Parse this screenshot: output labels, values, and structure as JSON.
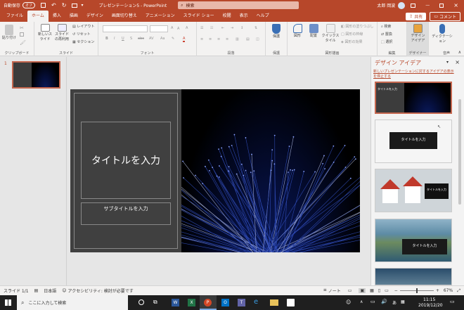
{
  "titlebar": {
    "autosave": "自動保存",
    "autosave_state": "オフ",
    "doc_title": "プレゼンテーション5 - PowerPoint",
    "search_placeholder": "検索",
    "user": "太郎 岡波"
  },
  "tabs": [
    "ファイル",
    "ホーム",
    "挿入",
    "描画",
    "デザイン",
    "画面切り替え",
    "アニメーション",
    "スライド ショー",
    "校閲",
    "表示",
    "ヘルプ"
  ],
  "share": "共有",
  "comment": "コメント",
  "ribbon": {
    "clipboard": {
      "paste": "貼り付け",
      "label": "クリップボード"
    },
    "slides": {
      "new": "新しいスライド",
      "reuse": "スライドの再利用",
      "layout": "レイアウト",
      "reset": "リセット",
      "section": "セクション",
      "label": "スライド"
    },
    "font": {
      "label": "フォント"
    },
    "paragraph": {
      "label": "段落"
    },
    "protect": {
      "btn": "保護",
      "label": "保護"
    },
    "draw": {
      "shapes": "図形",
      "arrange": "配置",
      "quickstyle": "クイックスタイル",
      "fill": "図形の塗りつぶし",
      "outline": "図形の枠線",
      "effect": "図形の効果",
      "label": "図形描画"
    },
    "edit": {
      "find": "検索",
      "replace": "置換",
      "select": "選択",
      "label": "編集"
    },
    "designer": {
      "btn": "デザインアイデア",
      "label": "デザイナー"
    },
    "voice": {
      "btn": "ディクテーション",
      "label": "音声"
    }
  },
  "slide": {
    "number": "1",
    "title": "タイトルを入力",
    "subtitle": "サブタイトルを入力"
  },
  "pane": {
    "title": "デザイン アイデア",
    "link": "新しいプレゼンテーションに対するアイデアの表示を停止する",
    "thumb_title": "タイトルを入力",
    "thumb_sub": "サブタイトルを入力"
  },
  "status": {
    "slide": "スライド 1/1",
    "lang": "日本語",
    "access": "アクセシビリティ: 検討が必要です",
    "notes": "ノート",
    "zoom": "67%"
  },
  "taskbar": {
    "search": "ここに入力して検索",
    "time": "11:15",
    "date": "2019/12/20"
  }
}
